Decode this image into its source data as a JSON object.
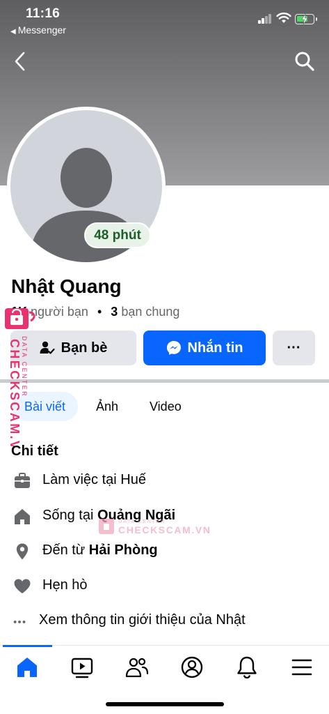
{
  "status_bar": {
    "time": "11:16",
    "back_app": "Messenger"
  },
  "icons": {
    "back": "chevron-left-icon",
    "search": "search-icon",
    "friends_button": "person-check-icon",
    "message_button": "messenger-icon",
    "work": "briefcase-icon",
    "home": "house-icon",
    "from": "location-pin-icon",
    "dating": "heart-icon",
    "more": "ellipsis-icon"
  },
  "profile": {
    "active_status": "48 phút",
    "name": "Nhật Quang",
    "friend_count": "1K",
    "friend_label": "người bạn",
    "separator": "•",
    "mutual_count": "3",
    "mutual_label": "bạn chung"
  },
  "actions": {
    "friends_label": "Bạn bè",
    "message_label": "Nhắn tin",
    "more_label": "···"
  },
  "tabs": [
    {
      "label": "Bài viết",
      "active": true
    },
    {
      "label": "Ảnh",
      "active": false
    },
    {
      "label": "Video",
      "active": false
    }
  ],
  "details": {
    "title": "Chi tiết",
    "work": "Làm việc tại Huế",
    "lives_prefix": "Sống tại ",
    "lives_place": "Quảng Ngãi",
    "from_prefix": "Đến từ ",
    "from_place": "Hải Phòng",
    "dating": "Hẹn hò",
    "see_more": "Xem thông tin giới thiệu của Nhật"
  },
  "watermark": {
    "vertical_brand": "CHECKSCAM.VN",
    "vertical_sub": "DATA CENTER",
    "center_brand": "CHECKSCAM.VN",
    "center_sub": "DATA CENTER"
  },
  "bottom_nav": [
    "home-icon",
    "video-icon",
    "friends-icon",
    "profile-icon",
    "bell-icon",
    "menu-icon"
  ],
  "colors": {
    "accent": "#0866ff",
    "active_badge_bg": "#e7f3e8",
    "active_badge_text": "#1e5f26",
    "watermark": "#e8336f"
  }
}
